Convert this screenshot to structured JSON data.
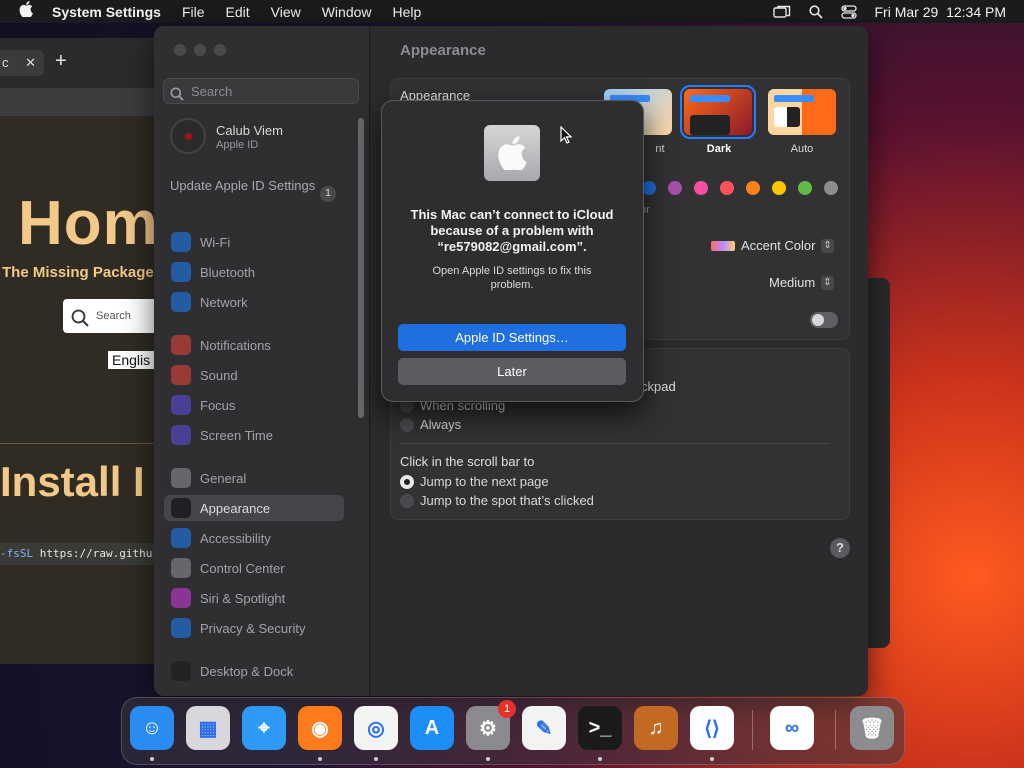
{
  "menubar": {
    "app_name": "System Settings",
    "menus": [
      "File",
      "Edit",
      "View",
      "Window",
      "Help"
    ],
    "datetime": "Fri Mar 29  12:34 PM",
    "icons": [
      "apple-logo-icon",
      "screen-mirroring-icon",
      "spotlight-search-icon",
      "control-center-icon"
    ]
  },
  "browser": {
    "tab_partial": "c",
    "hero_title": "Hom",
    "tagline": "The Missing Package",
    "search_placeholder": "Search",
    "language": "Englis",
    "install_heading": "Install I",
    "code_flag": "-fsSL",
    "code_url": "https://raw.githu"
  },
  "sidebar": {
    "search_placeholder": "Search",
    "profile": {
      "name": "Calub Viem",
      "subtitle": "Apple ID"
    },
    "update": {
      "label": "Update Apple ID Settings",
      "badge": "1"
    },
    "items": [
      {
        "label": "Wi-Fi",
        "icon": "wifi-icon",
        "color": "#1e7cf2"
      },
      {
        "label": "Bluetooth",
        "icon": "bluetooth-icon",
        "color": "#1e7cf2"
      },
      {
        "label": "Network",
        "icon": "globe-icon",
        "color": "#1e7cf2"
      },
      {
        "label": "Notifications",
        "icon": "bell-icon",
        "color": "#e0453a"
      },
      {
        "label": "Sound",
        "icon": "speaker-icon",
        "color": "#e0453a"
      },
      {
        "label": "Focus",
        "icon": "moon-icon",
        "color": "#5b4bd6"
      },
      {
        "label": "Screen Time",
        "icon": "hourglass-icon",
        "color": "#5b4bd6"
      },
      {
        "label": "General",
        "icon": "gear-icon",
        "color": "#8e8e93"
      },
      {
        "label": "Appearance",
        "icon": "appearance-icon",
        "color": "#1c1c1e"
      },
      {
        "label": "Accessibility",
        "icon": "accessibility-icon",
        "color": "#1e7cf2"
      },
      {
        "label": "Control Center",
        "icon": "control-center-icon",
        "color": "#8e8e93"
      },
      {
        "label": "Siri & Spotlight",
        "icon": "siri-icon",
        "color": "#c63bd6"
      },
      {
        "label": "Privacy & Security",
        "icon": "hand-icon",
        "color": "#1e7cf2"
      },
      {
        "label": "Desktop & Dock",
        "icon": "dock-icon",
        "color": "#1c1c1e"
      }
    ],
    "selected": "Appearance"
  },
  "main": {
    "title": "Appearance",
    "appearance_label": "Appearance",
    "modes": [
      {
        "label": "nt",
        "selected": false
      },
      {
        "label": "Dark",
        "selected": true
      },
      {
        "label": "Auto",
        "selected": false
      }
    ],
    "accent_colors": [
      "#1f6fe0",
      "#a550a7",
      "#f74f9e",
      "#ff5257",
      "#f7821b",
      "#ffc600",
      "#62ba46",
      "#8c8c8c"
    ],
    "accent_fragment": "or",
    "highlight_color": "Accent Color",
    "sidebar_icon_size": "Medium",
    "scroll_fragment": "ckpad",
    "scroll_options": [
      {
        "label": "When scrolling",
        "selected": false
      },
      {
        "label": "Always",
        "selected": false
      }
    ],
    "click_label": "Click in the scroll bar to",
    "click_options": [
      {
        "label": "Jump to the next page",
        "selected": true
      },
      {
        "label": "Jump to the spot that’s clicked",
        "selected": false
      }
    ],
    "help": "?"
  },
  "dialog": {
    "message": "This Mac can’t connect to iCloud because of a problem with “re579082@gmail.com”.",
    "info": "Open Apple ID settings to fix this problem.",
    "primary_button": "Apple ID Settings…",
    "secondary_button": "Later"
  },
  "dock": {
    "apps": [
      {
        "name": "Finder",
        "icon": "finder-icon",
        "color": "#2a8cf0",
        "running": true
      },
      {
        "name": "Launchpad",
        "icon": "launchpad-icon",
        "color": "#d8d8dc",
        "running": false
      },
      {
        "name": "Safari",
        "icon": "safari-icon",
        "color": "#2f9af5",
        "running": false
      },
      {
        "name": "Firefox",
        "icon": "firefox-icon",
        "color": "#ff7a1a",
        "running": true
      },
      {
        "name": "Chrome",
        "icon": "chrome-icon",
        "color": "#f4f4f4",
        "running": true
      },
      {
        "name": "App Store",
        "icon": "app-store-icon",
        "color": "#1e8ef7",
        "running": false
      },
      {
        "name": "System Settings",
        "icon": "system-settings-icon",
        "color": "#8a8a8f",
        "running": true,
        "badge": "1"
      },
      {
        "name": "TextEdit",
        "icon": "textedit-icon",
        "color": "#f3f3f3",
        "running": false
      },
      {
        "name": "Terminal",
        "icon": "terminal-icon",
        "color": "#1a1a1a",
        "running": true
      },
      {
        "name": "GarageBand",
        "icon": "garageband-icon",
        "color": "#c26a22",
        "running": false
      },
      {
        "name": "Visual Studio Code",
        "icon": "vscode-icon",
        "color": "#ffffff",
        "running": true
      },
      {
        "name": "Visual Studio",
        "icon": "visual-studio-icon",
        "color": "#ffffff",
        "running": false
      },
      {
        "name": "Trash",
        "icon": "trash-icon",
        "color": "#8c8c8f",
        "running": false
      }
    ]
  }
}
